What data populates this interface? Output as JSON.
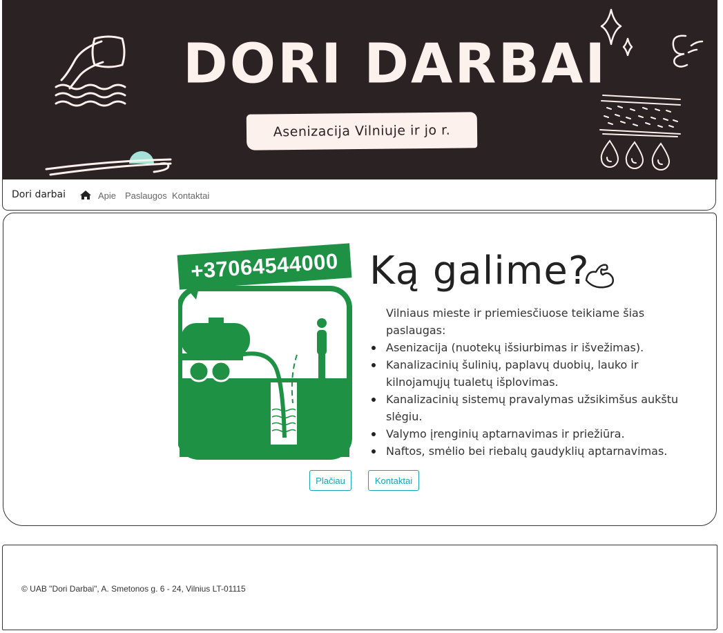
{
  "banner": {
    "title": "DORI DARBAI",
    "subtitle": "Asenizacija Vilniuje ir jo r."
  },
  "navbar": {
    "brand": "Dori darbai",
    "home_icon": "home-icon",
    "links": [
      "Apie",
      "Paslaugos",
      "Kontaktai"
    ]
  },
  "main": {
    "phone": "+37064544000",
    "heading": "Ką galime?",
    "heading_icon": "flexed-arm-icon",
    "intro": "Vilniaus mieste ir priemiesčiuose teikiame šias paslaugas:",
    "services": [
      "Asenizacija (nuotekų išsiurbimas ir išvežimas).",
      "Kanalizacinių šulinių, paplavų duobių, lauko ir kilnojamųjų tualetų išplovimas.",
      "Kanalizacinių sistemų pravalymas užsikimšus aukštu slėgiu.",
      "Valymo įrenginių aptarnavimas ir priežiūra.",
      "Naftos, smėlio bei riebalų gaudyklių aptarnavimas."
    ],
    "buttons": {
      "more": "Plačiau",
      "contacts": "Kontaktai"
    }
  },
  "footer": {
    "text": "© UAB \"Dori Darbai\", A. Smetonos g. 6 - 24, Vilnius LT-01115"
  },
  "colors": {
    "banner_bg": "#2b2223",
    "banner_text": "#fdf1ed",
    "illustration_green": "#1e9145",
    "button_accent": "#17a2b8",
    "accent_mint": "#a6e2d9"
  }
}
